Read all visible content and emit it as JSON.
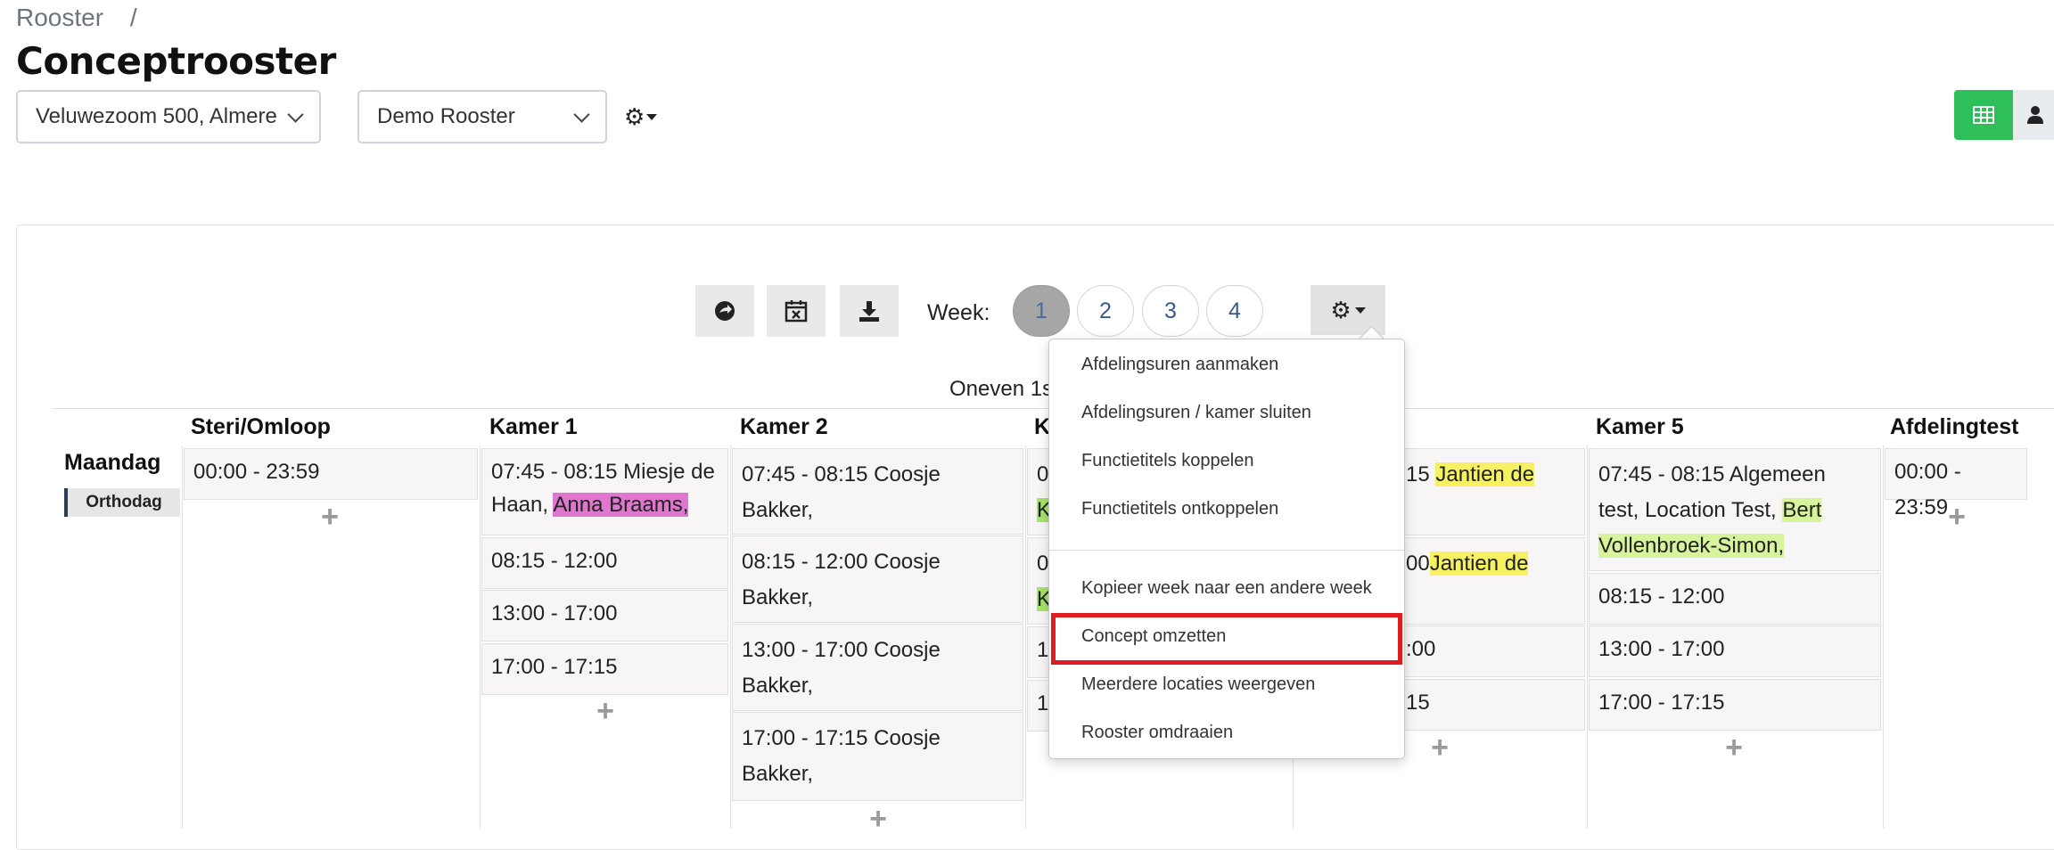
{
  "breadcrumb": {
    "root": "Rooster",
    "separator": "/"
  },
  "page_title": "Conceptrooster",
  "location_select": {
    "value": "Veluwezoom 500, Almere"
  },
  "rooster_select": {
    "value": "Demo Rooster"
  },
  "toolbar": {
    "week_label": "Week:",
    "weeks": [
      "1",
      "2",
      "3",
      "4"
    ],
    "active_week": "1"
  },
  "partial_heading": "Oneven 1s",
  "columns": [
    {
      "title": "Steri/Omloop"
    },
    {
      "title": "Kamer 1"
    },
    {
      "title": "Kamer 2"
    },
    {
      "title": "K"
    },
    {
      "title": "Kamer 5"
    },
    {
      "title": "Afdelingtest"
    }
  ],
  "day": {
    "name": "Maandag",
    "tag": "Orthodag"
  },
  "slots": {
    "steri": [
      "00:00 - 23:59"
    ],
    "kamer1": {
      "s1_time": "07:45 - 08:15 Miesje de",
      "s1_line2": "Haan,",
      "s1_highlight": "Anna Braams,",
      "s2": "08:15 - 12:00",
      "s3": "13:00 - 17:00",
      "s4": "17:00 - 17:15"
    },
    "kamer2": {
      "s1a": "07:45 - 08:15 Coosje",
      "s1b": "Bakker,",
      "s2a": "08:15 - 12:00 Coosje",
      "s2b": "Bakker,",
      "s3a": "13:00 - 17:00 Coosje",
      "s3b": "Bakker,",
      "s4a": "17:00 - 17:15 Coosje",
      "s4b": "Bakker,"
    },
    "kamer3_partial": {
      "r1a": "0",
      "r1b": "K",
      "r2a": "0",
      "r2b": "K",
      "r3": "1",
      "r4": "1"
    },
    "kamer4_partial": {
      "r1_time": "15",
      "r1_name": "Jantien de",
      "r2_time": "00",
      "r2_name": "Jantien de",
      "r3": ":00",
      "r4": "15"
    },
    "kamer5": {
      "s1a": "07:45 - 08:15 Algemeen",
      "s1b": "test, Location Test,",
      "s1c": "Bert",
      "s1d": "Vollenbroek-Simon,",
      "s2": "08:15 - 12:00",
      "s3": "13:00 - 17:00",
      "s4": "17:00 - 17:15"
    },
    "afdelingtest": [
      "00:00 - 23:59"
    ]
  },
  "plus_symbol": "+",
  "dropdown_menu": {
    "items": [
      "Afdelingsuren aanmaken",
      "Afdelingsuren / kamer sluiten",
      "Functietitels koppelen",
      "Functietitels ontkoppelen",
      "Kopieer week naar een andere week",
      "Concept omzetten",
      "Meerdere locaties weergeven",
      "Rooster omdraaien"
    ],
    "highlighted_item": "Concept omzetten",
    "highlight_color": "#e11b22"
  },
  "colors": {
    "primary_green": "#2fbf5a",
    "pink": "#df77cf",
    "yellow": "#f6f063",
    "light_green": "#d7f39b"
  },
  "icons": [
    "gear-icon",
    "table-icon",
    "user-icon",
    "share-icon",
    "calendar-x-icon",
    "download-icon",
    "plus-icon"
  ]
}
